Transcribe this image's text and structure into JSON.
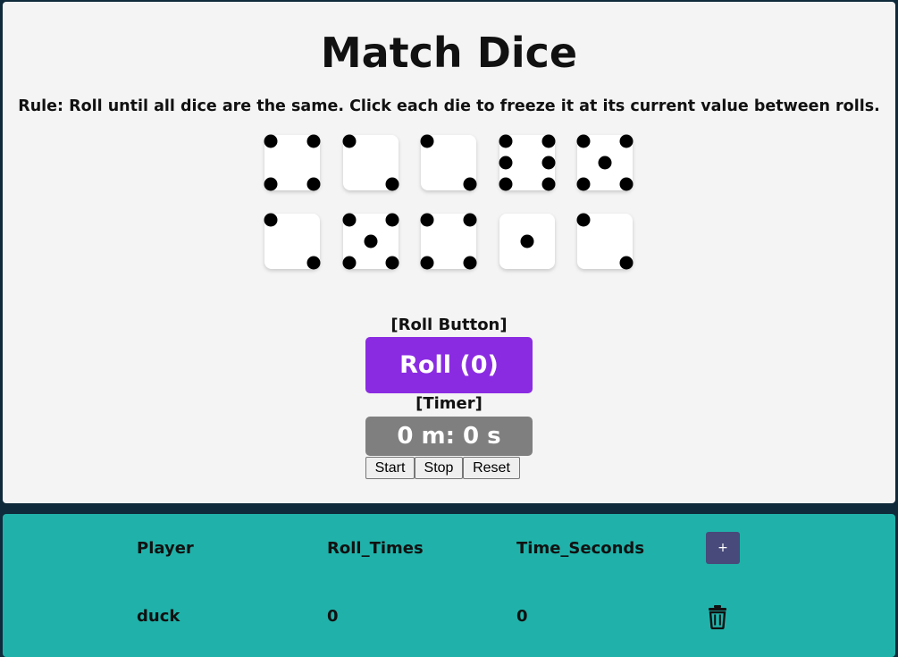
{
  "game": {
    "title": "Match Dice",
    "rule": "Rule: Roll until all dice are the same. Click each die to freeze it at its current value between rolls.",
    "dice": [
      4,
      2,
      2,
      6,
      5,
      2,
      5,
      4,
      1,
      2
    ],
    "roll_label": "[Roll Button]",
    "roll_button": "Roll (0)",
    "timer_label": "[Timer]",
    "timer_value": "0 m: 0 s",
    "start": "Start",
    "stop": "Stop",
    "reset": "Reset"
  },
  "table": {
    "headers": [
      "Player",
      "Roll_Times",
      "Time_Seconds"
    ],
    "add_button": "+",
    "rows": [
      {
        "player": "duck",
        "roll_times": "0",
        "time_seconds": "0"
      }
    ]
  }
}
